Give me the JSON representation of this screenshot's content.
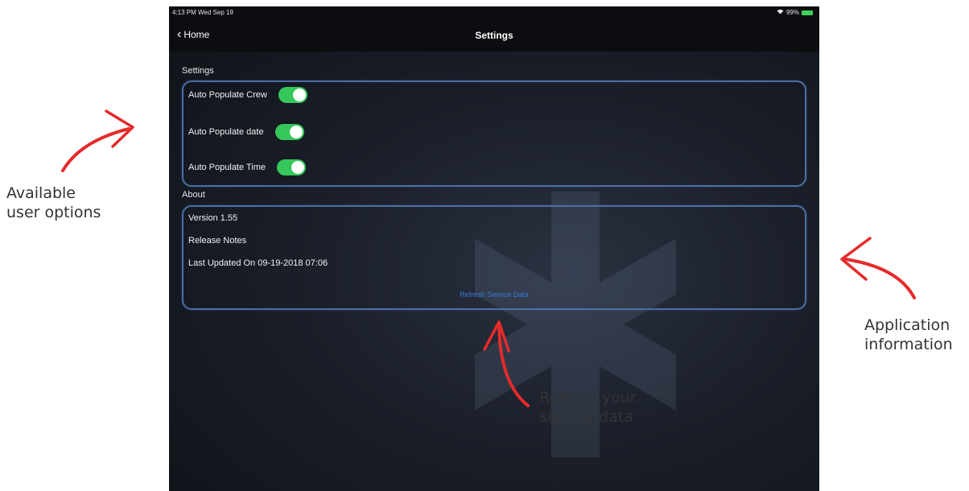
{
  "statusbar": {
    "time": "4:13 PM  Wed Sep 19",
    "battery": "99%"
  },
  "nav": {
    "back_label": "Home",
    "title": "Settings"
  },
  "settings": {
    "section_label": "Settings",
    "options": [
      {
        "label": "Auto Populate Crew",
        "on": true
      },
      {
        "label": "Auto Populate date",
        "on": true
      },
      {
        "label": "Auto Populate Time",
        "on": true
      }
    ]
  },
  "about": {
    "section_label": "About",
    "version": "Version 1.55",
    "release_notes": "Release Notes",
    "last_updated": "Last Updated On 09-19-2018 07:06",
    "refresh_label": "Refresh Service Data"
  },
  "annotations": {
    "left_1": "Available",
    "left_2": "user options",
    "right_1": "Application",
    "right_2": "information",
    "bottom_1": "Refresh your",
    "bottom_2": "service data"
  },
  "colors": {
    "toggle_on": "#36c75a",
    "panel_border": "#4c6ea8",
    "link": "#3a7bd8",
    "arrow": "#e52b2b"
  }
}
